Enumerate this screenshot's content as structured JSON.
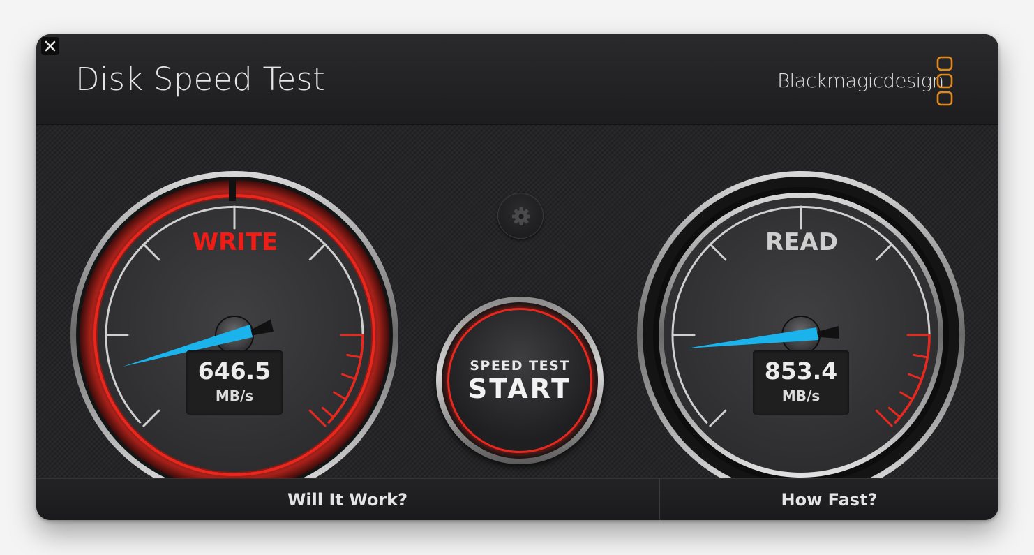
{
  "app": {
    "title": "Disk Speed Test",
    "brand": "Blackmagicdesign"
  },
  "gauges": {
    "write": {
      "label": "WRITE",
      "value": "646.5",
      "unit": "MB/s",
      "label_color": "#f11c16"
    },
    "read": {
      "label": "READ",
      "value": "853.4",
      "unit": "MB/s",
      "label_color": "#cfcfcf"
    }
  },
  "start_button": {
    "top_label": "SPEED TEST",
    "main_label": "START"
  },
  "footer": {
    "will_it_work": "Will It Work?",
    "how_fast": "How Fast?"
  },
  "colors": {
    "needle": "#1ab3ec",
    "accent_red": "#e8281e",
    "brand_orange": "#e0891e"
  },
  "icons": {
    "close": "close-icon",
    "settings": "gear-icon",
    "logo": "blackmagic-logo-icon"
  }
}
